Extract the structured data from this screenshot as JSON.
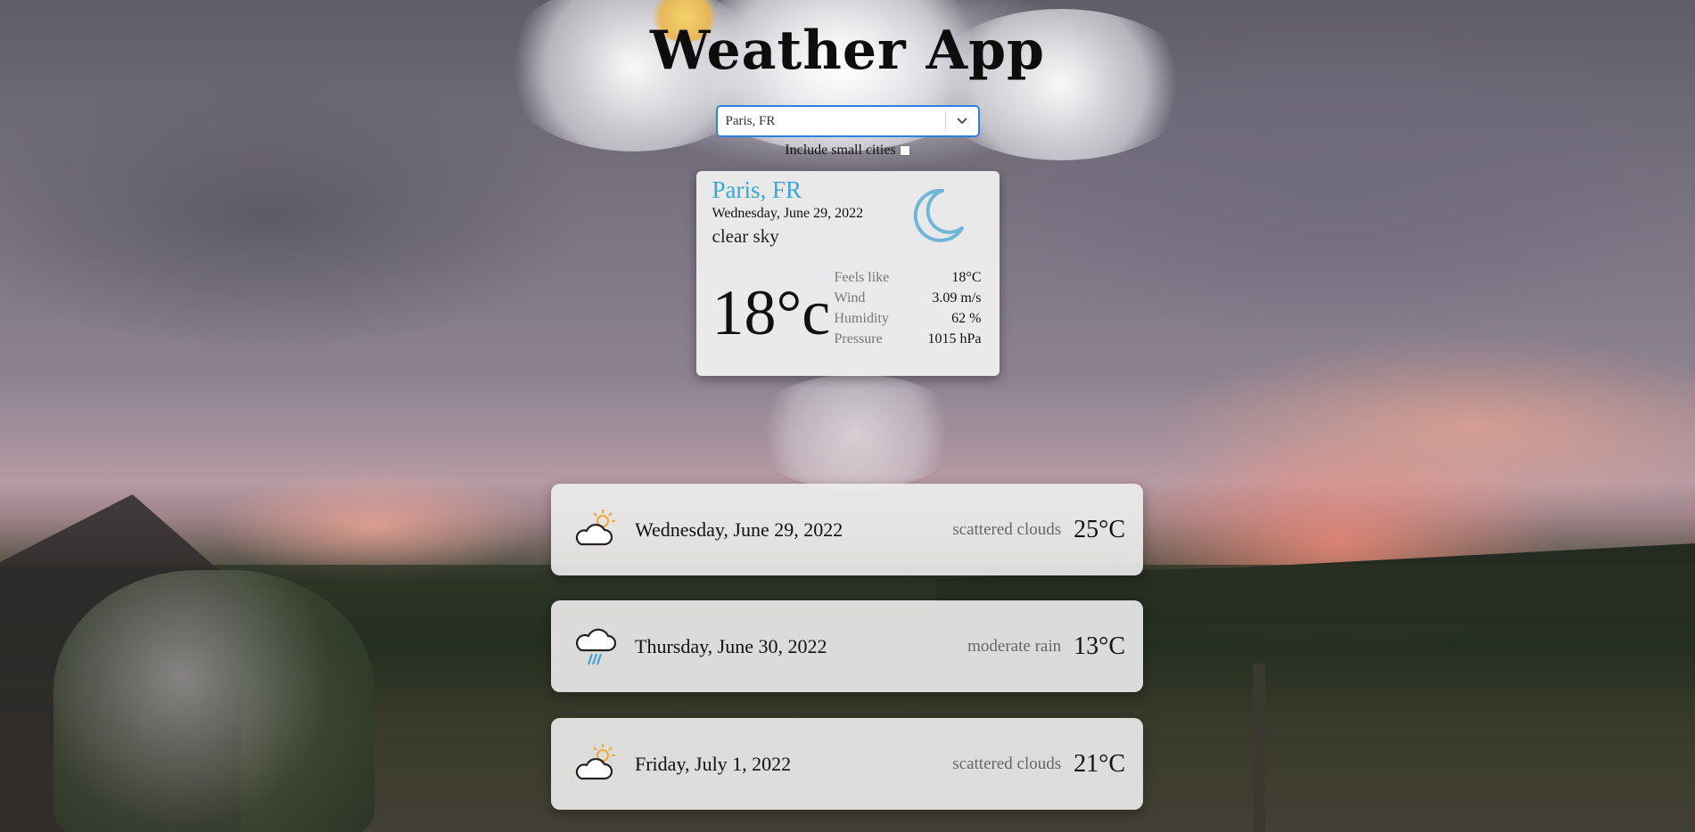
{
  "app": {
    "title": "Weather App"
  },
  "search": {
    "selected_value": "Paris, FR",
    "small_cities_label": "Include small cities",
    "small_cities_checked": false
  },
  "current": {
    "city": "Paris, FR",
    "date": "Wednesday, June 29, 2022",
    "description": "clear sky",
    "temperature": "18°c",
    "icon": "moon-icon",
    "details": [
      {
        "label": "Feels like",
        "value": "18°C"
      },
      {
        "label": "Wind",
        "value": "3.09 m/s"
      },
      {
        "label": "Humidity",
        "value": "62 %"
      },
      {
        "label": "Pressure",
        "value": "1015 hPa"
      }
    ]
  },
  "forecast": [
    {
      "date": "Wednesday, June 29, 2022",
      "description": "scattered clouds",
      "temperature": "25°C",
      "icon": "sun-cloud-icon"
    },
    {
      "date": "Thursday, June 30, 2022",
      "description": "moderate rain",
      "temperature": "13°C",
      "icon": "rain-cloud-icon"
    },
    {
      "date": "Friday, July 1, 2022",
      "description": "scattered clouds",
      "temperature": "21°C",
      "icon": "sun-cloud-icon"
    }
  ],
  "colors": {
    "accent": "#3aa8d6",
    "select_border": "#2f7fe0"
  }
}
